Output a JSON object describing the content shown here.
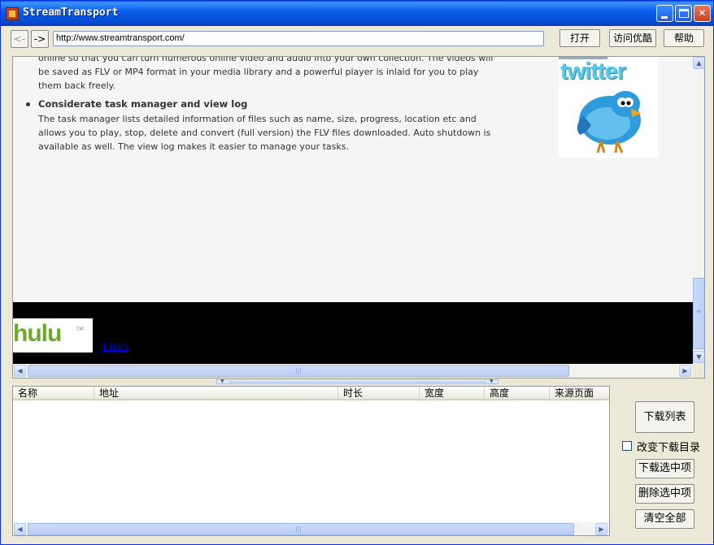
{
  "window": {
    "title": "StreamTransport",
    "controls": {
      "minimize": "minimize-icon",
      "maximize": "maximize-icon",
      "close": "close-icon"
    }
  },
  "toolbar": {
    "back_label": "<-",
    "forward_label": "->",
    "url": "http://www.streamtransport.com/",
    "open_label": "打开",
    "visit_label": "访问优酷",
    "help_label": "帮助"
  },
  "webpage": {
    "paragraph1": "online so that you can turn numerous online video and audio into your own collection. The videos will be saved as FLV or MP4 format in your media library and a powerful player is inlaid for you to play them back freely.",
    "heading2": "Considerate task manager and view log",
    "paragraph2": "The task manager lists detailed information of files such as name, size, progress, location etc and allows you to play, stop, delete and convert (full version) the FLV files downloaded. Auto shutdown is available as well. The view log makes it easier to manage your tasks.",
    "twitter_logo": "twitter",
    "hulu_logo": "hulu",
    "hulu_tm": "TM",
    "links_label": "Links"
  },
  "list": {
    "columns": [
      "名称",
      "地址",
      "时长",
      "宽度",
      "高度",
      "来源页面"
    ],
    "rows": []
  },
  "side_panel": {
    "download_list_label": "下载列表",
    "change_dir_label": "改变下载目录",
    "change_dir_checked": false,
    "download_selected_label": "下载选中项",
    "delete_selected_label": "删除选中项",
    "clear_all_label": "清空全部"
  },
  "colors": {
    "titlebar": "#0A5FE8",
    "window_bg": "#ECE9D8",
    "link": "#0000EE",
    "twitter_blue": "#5CC8E8",
    "hulu_green": "#6EAA2A"
  }
}
